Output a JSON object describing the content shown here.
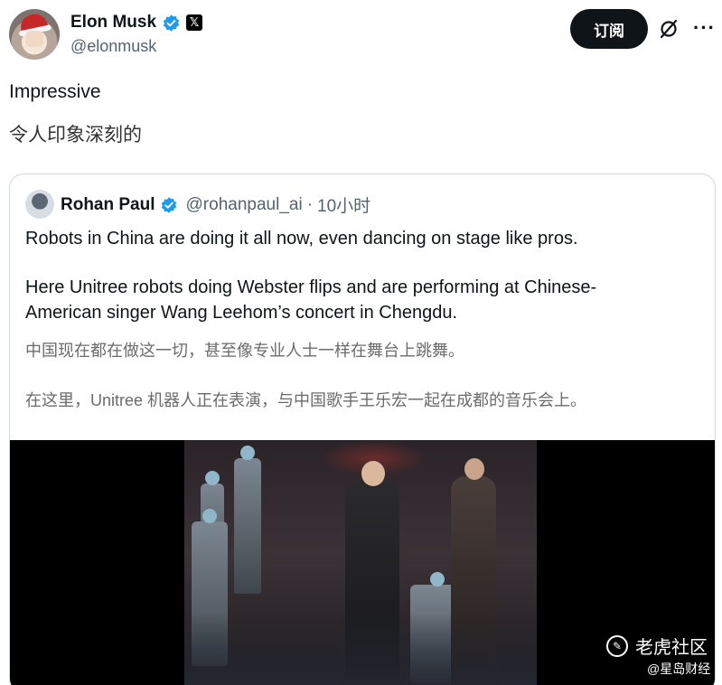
{
  "post": {
    "author": {
      "display_name": "Elon Musk",
      "handle": "@elonmusk",
      "verified_icon": "verified-badge-icon",
      "affiliate_badge": "𝕏"
    },
    "subscribe_label": "订阅",
    "text": "Impressive",
    "translation": "令人印象深刻的"
  },
  "quoted_post": {
    "author": {
      "display_name": "Rohan Paul",
      "handle": "@rohanpaul_ai",
      "separator": "·",
      "time": "10小时"
    },
    "lines": {
      "l1": "Robots in China are doing it all now, even dancing on stage like pros.",
      "l2": "Here Unitree robots doing Webster flips and are performing at Chinese-",
      "l3": "American singer Wang Leehom’s concert in Chengdu.",
      "cn1": "中国现在都在做这一切，甚至像专业人士一样在舞台上跳舞。",
      "cn2": "在这里，Unitree 机器人正在表演，与中国歌手王乐宏一起在成都的音乐会上。"
    }
  },
  "watermark": {
    "brand": "老虎社区",
    "source": "@星岛财经"
  },
  "colors": {
    "primary_text": "#0f1419",
    "secondary_text": "#536471",
    "verified_blue": "#1d9bf0",
    "border": "#cfd9de"
  }
}
